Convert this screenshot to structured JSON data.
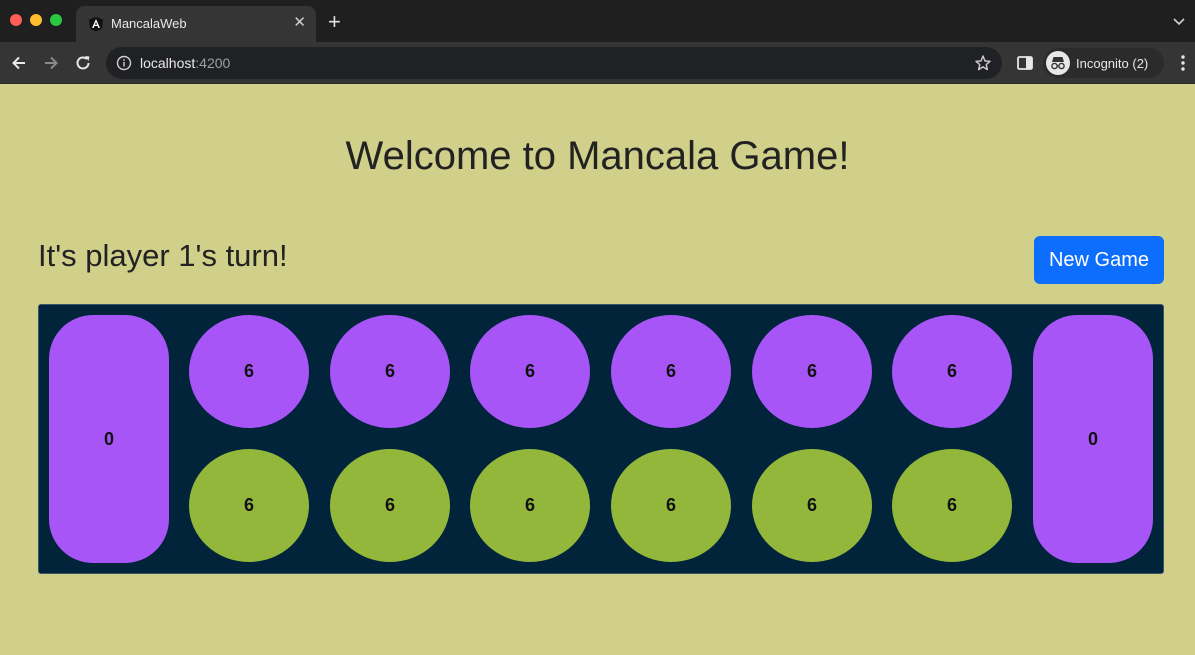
{
  "browser": {
    "tab_title": "MancalaWeb",
    "url_host": "localhost",
    "url_port": ":4200",
    "profile_label": "Incognito (2)"
  },
  "page": {
    "title": "Welcome to Mancala Game!",
    "turn_text": "It's player 1's turn!",
    "new_game_label": "New Game"
  },
  "board": {
    "store_left": "0",
    "store_right": "0",
    "top_row": [
      "6",
      "6",
      "6",
      "6",
      "6",
      "6"
    ],
    "bottom_row": [
      "6",
      "6",
      "6",
      "6",
      "6",
      "6"
    ],
    "colors": {
      "board": "#02243a",
      "player2_pits": "#a855f7",
      "player1_pits": "#92b73b",
      "stores": "#a855f7"
    }
  }
}
